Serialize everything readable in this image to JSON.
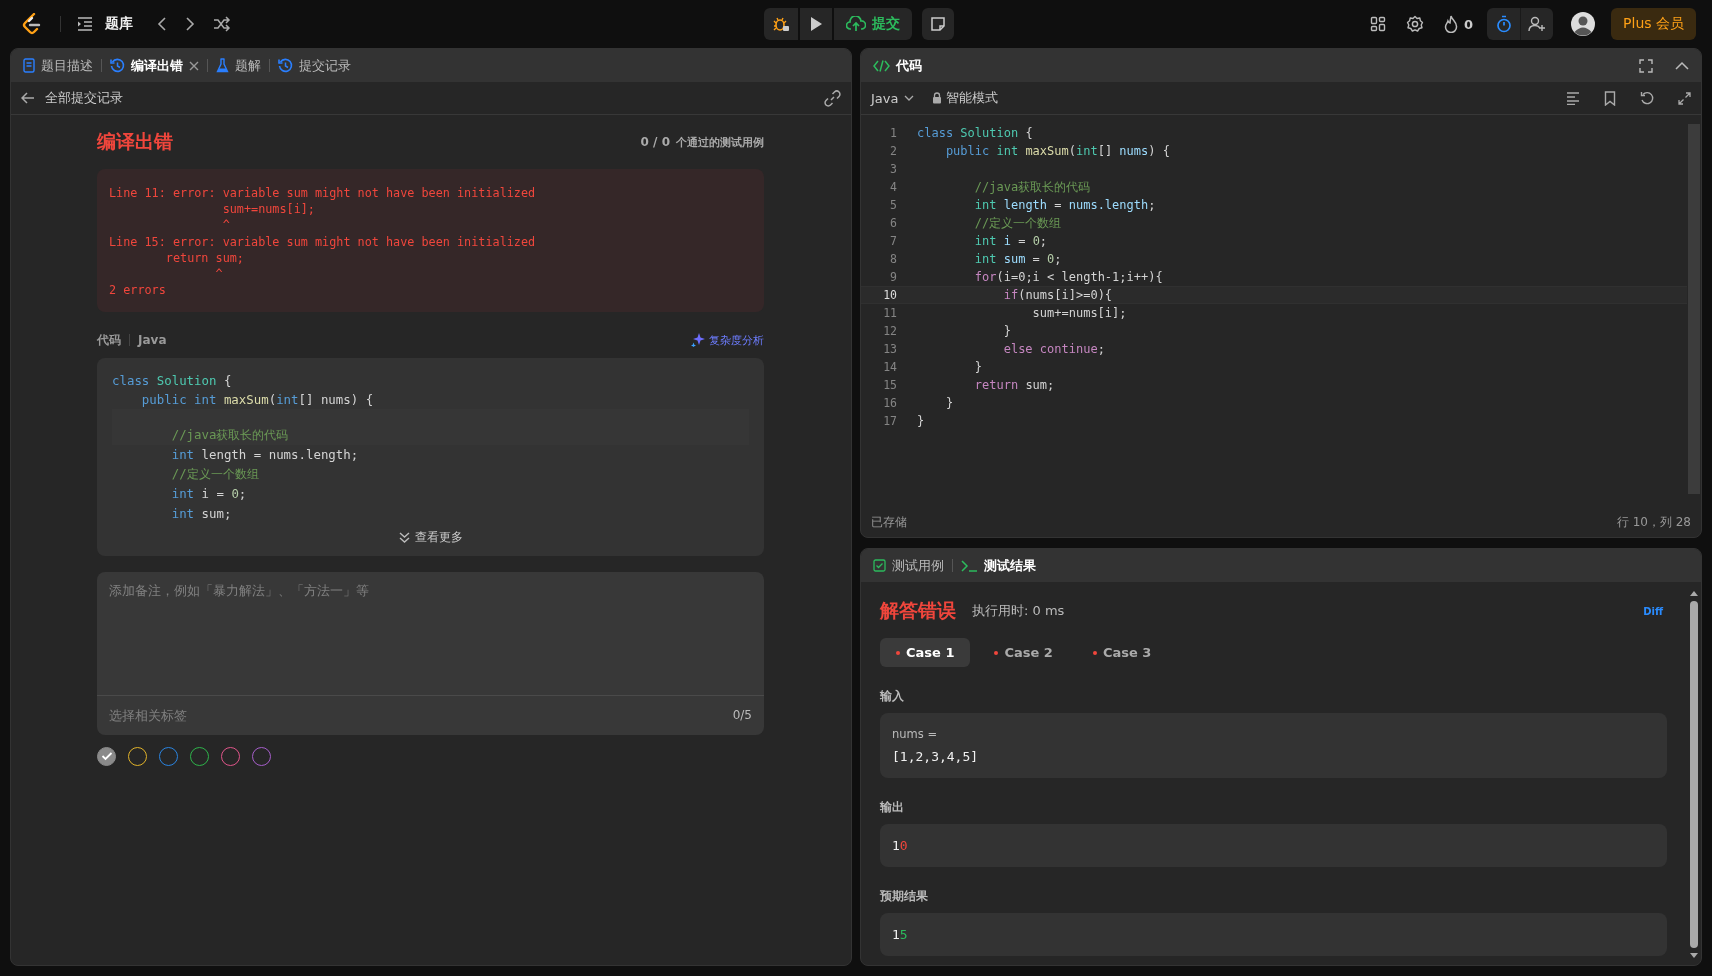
{
  "topbar": {
    "problem_bank": "题库",
    "submit": "提交",
    "streak": "0",
    "plus": "Plus 会员"
  },
  "left_panel": {
    "tabs": [
      {
        "label": "题目描述",
        "kind": "description",
        "selected": false,
        "closable": false
      },
      {
        "label": "编译出错",
        "kind": "history",
        "selected": true,
        "closable": true
      },
      {
        "label": "题解",
        "kind": "solution",
        "selected": false,
        "closable": false
      },
      {
        "label": "提交记录",
        "kind": "history",
        "selected": false,
        "closable": false
      }
    ],
    "back": "全部提交记录",
    "result": {
      "title": "编译出错",
      "passed": "0 / 0",
      "passed_label": "个通过的测试用例"
    },
    "error_lines": [
      "Line 11: error: variable sum might not have been initialized",
      "                sum+=nums[i];",
      "                ^",
      "Line 15: error: variable sum might not have been initialized",
      "        return sum;",
      "               ^",
      "2 errors"
    ],
    "code_label": "代码",
    "code_lang": "Java",
    "complexity": "复杂度分析",
    "code": [
      {
        "blank_before": false,
        "tokens": [
          {
            "text": "class ",
            "kind": "kw"
          },
          {
            "text": "Solution",
            "kind": "type"
          },
          {
            "text": " {",
            "kind": "p"
          }
        ]
      },
      {
        "blank_before": false,
        "tokens": [
          {
            "text": "    public int ",
            "kind": "kw"
          },
          {
            "text": "maxSum",
            "kind": "fn"
          },
          {
            "text": "(",
            "kind": "p"
          },
          {
            "text": "int",
            "kind": "kw"
          },
          {
            "text": "[] nums) {",
            "kind": "p"
          }
        ]
      },
      {
        "blank_before": true,
        "tokens": [
          {
            "text": "        //java获取长的代码",
            "kind": "cm"
          }
        ]
      },
      {
        "blank_before": false,
        "tokens": [
          {
            "text": "        int ",
            "kind": "kw"
          },
          {
            "text": "length = nums.length;",
            "kind": "p"
          }
        ]
      },
      {
        "blank_before": false,
        "tokens": [
          {
            "text": "        //定义一个数组",
            "kind": "cm"
          }
        ]
      },
      {
        "blank_before": false,
        "tokens": [
          {
            "text": "        int ",
            "kind": "kw"
          },
          {
            "text": "i = ",
            "kind": "p"
          },
          {
            "text": "0",
            "kind": "num"
          },
          {
            "text": ";",
            "kind": "p"
          }
        ]
      },
      {
        "blank_before": false,
        "tokens": [
          {
            "text": "        int ",
            "kind": "kw"
          },
          {
            "text": "sum;",
            "kind": "p"
          }
        ]
      }
    ],
    "more": "查看更多",
    "note": {
      "placeholder": "添加备注，例如「暴力解法」、「方法一」等"
    },
    "tags": {
      "placeholder": "选择相关标签",
      "count": "0/5"
    },
    "colors": [
      {
        "color": "#8a8a8a",
        "selected": true
      },
      {
        "color": "#e0b22a",
        "selected": false
      },
      {
        "color": "#2a84e0",
        "selected": false
      },
      {
        "color": "#2eb34a",
        "selected": false
      },
      {
        "color": "#e0558a",
        "selected": false
      },
      {
        "color": "#a55ec9",
        "selected": false
      }
    ]
  },
  "code_panel": {
    "title": "代码",
    "language": "Java",
    "mode": "智能模式",
    "saved": "已存储",
    "cursor": "行 10，列 28",
    "lines": [
      {
        "n": "1",
        "selected": false,
        "tokens": [
          {
            "text": "class ",
            "kind": "kw"
          },
          {
            "text": "Solution",
            "kind": "type"
          },
          {
            "text": " {",
            "kind": "p"
          }
        ]
      },
      {
        "n": "2",
        "selected": false,
        "tokens": [
          {
            "text": "    public ",
            "kind": "kw"
          },
          {
            "text": "int ",
            "kind": "type"
          },
          {
            "text": "maxSum",
            "kind": "fn"
          },
          {
            "text": "(",
            "kind": "p"
          },
          {
            "text": "int",
            "kind": "type"
          },
          {
            "text": "[] ",
            "kind": "p"
          },
          {
            "text": "nums",
            "kind": "var"
          },
          {
            "text": ") {",
            "kind": "p"
          }
        ]
      },
      {
        "n": "3",
        "selected": false
      },
      {
        "n": "4",
        "selected": false,
        "tokens": [
          {
            "text": "        //java获取长的代码",
            "kind": "cm"
          }
        ]
      },
      {
        "n": "5",
        "selected": false,
        "tokens": [
          {
            "text": "        int ",
            "kind": "type"
          },
          {
            "text": "length",
            "kind": "var"
          },
          {
            "text": " = ",
            "kind": "p"
          },
          {
            "text": "nums.length",
            "kind": "var"
          },
          {
            "text": ";",
            "kind": "p"
          }
        ]
      },
      {
        "n": "6",
        "selected": false,
        "tokens": [
          {
            "text": "        //定义一个数组",
            "kind": "cm"
          }
        ]
      },
      {
        "n": "7",
        "selected": false,
        "tokens": [
          {
            "text": "        int ",
            "kind": "type"
          },
          {
            "text": "i",
            "kind": "var"
          },
          {
            "text": " = ",
            "kind": "p"
          },
          {
            "text": "0",
            "kind": "num"
          },
          {
            "text": ";",
            "kind": "p"
          }
        ]
      },
      {
        "n": "8",
        "selected": false,
        "tokens": [
          {
            "text": "        int ",
            "kind": "type"
          },
          {
            "text": "sum",
            "kind": "var"
          },
          {
            "text": " = ",
            "kind": "p"
          },
          {
            "text": "0",
            "kind": "num"
          },
          {
            "text": ";",
            "kind": "p"
          }
        ]
      },
      {
        "n": "9",
        "selected": false,
        "tokens": [
          {
            "text": "        for",
            "kind": "ctl"
          },
          {
            "text": "(i=0;i < length-1;i++){",
            "kind": "p"
          }
        ]
      },
      {
        "n": "10",
        "selected": true,
        "tokens": [
          {
            "text": "            if",
            "kind": "ctl"
          },
          {
            "text": "(nums[i]>=0){",
            "kind": "p"
          }
        ]
      },
      {
        "n": "11",
        "selected": false,
        "tokens": [
          {
            "text": "                sum+=nums[i];",
            "kind": "p"
          }
        ]
      },
      {
        "n": "12",
        "selected": false,
        "tokens": [
          {
            "text": "            }",
            "kind": "p"
          }
        ]
      },
      {
        "n": "13",
        "selected": false,
        "tokens": [
          {
            "text": "            else continue",
            "kind": "ctl"
          },
          {
            "text": ";",
            "kind": "p"
          }
        ]
      },
      {
        "n": "14",
        "selected": false,
        "tokens": [
          {
            "text": "        }",
            "kind": "p"
          }
        ]
      },
      {
        "n": "15",
        "selected": false,
        "tokens": [
          {
            "text": "        return ",
            "kind": "ctl"
          },
          {
            "text": "sum;",
            "kind": "p"
          }
        ]
      },
      {
        "n": "16",
        "selected": false,
        "tokens": [
          {
            "text": "    }",
            "kind": "p"
          }
        ]
      },
      {
        "n": "17",
        "selected": false,
        "tokens": [
          {
            "text": "}",
            "kind": "p"
          }
        ]
      }
    ]
  },
  "test_panel": {
    "tabs": [
      {
        "label": "测试用例",
        "kind": "cases",
        "selected": false
      },
      {
        "label": "测试结果",
        "kind": "terminal",
        "selected": true
      }
    ],
    "verdict": "解答错误",
    "runtime": "执行用时: 0 ms",
    "diff": "Diff",
    "cases": [
      {
        "label": "Case 1",
        "selected": true,
        "passed": false
      },
      {
        "label": "Case 2",
        "selected": false,
        "passed": false
      },
      {
        "label": "Case 3",
        "selected": false,
        "passed": false
      }
    ],
    "sections": [
      {
        "label": "输入",
        "var": "nums =",
        "value": [
          {
            "text": "[1,2,3,4,5]",
            "kind": "same"
          }
        ]
      },
      {
        "label": "输出",
        "value": [
          {
            "text": "1",
            "kind": "same"
          },
          {
            "text": "0",
            "kind": "diff"
          }
        ]
      },
      {
        "label": "预期结果",
        "value": [
          {
            "text": "1",
            "kind": "same"
          },
          {
            "text": "5",
            "kind": "ok"
          }
        ]
      }
    ]
  }
}
